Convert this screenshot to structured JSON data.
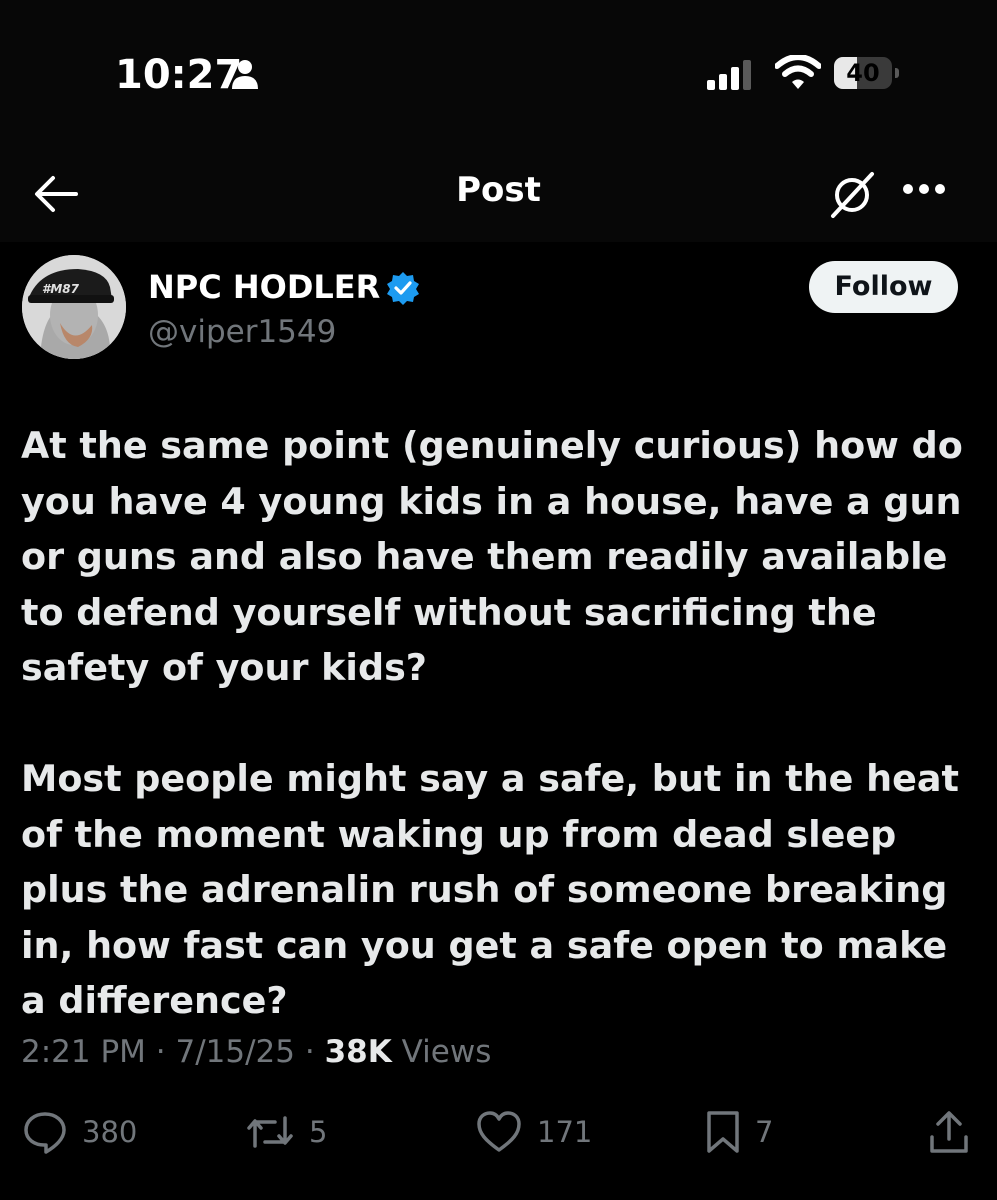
{
  "status_bar": {
    "time": "10:27",
    "battery_level": "40",
    "icons": [
      "person-icon",
      "cellular-signal-icon",
      "wifi-icon",
      "battery-icon"
    ]
  },
  "nav": {
    "title": "Post",
    "icons": [
      "back-arrow-icon",
      "grok-icon",
      "more-icon"
    ]
  },
  "author": {
    "display_name": "NPC HODLER",
    "handle": "@viper1549",
    "avatar_cap_text": "#M87",
    "verified": true
  },
  "follow_button": {
    "label": "Follow"
  },
  "post": {
    "paragraphs": [
      "At the same point (genuinely curious) how do you have 4 young kids in a house, have a gun or guns and also have them readily available to defend yourself without sacrificing the safety of your kids?",
      "Most people might say a safe, but in the heat of the moment waking up from dead sleep plus the adrenalin rush of someone breaking in, how fast can you get a safe open to make a difference?"
    ],
    "time": "2:21 PM",
    "date": "7/15/25",
    "separator": "·",
    "views_count": "38K",
    "views_label": "Views"
  },
  "actions": {
    "replies": "380",
    "reposts": "5",
    "likes": "171",
    "bookmarks": "7"
  },
  "colors": {
    "background": "#000000",
    "text": "#e7e9ea",
    "muted": "#71767b",
    "verified_blue": "#1d9bf0"
  }
}
